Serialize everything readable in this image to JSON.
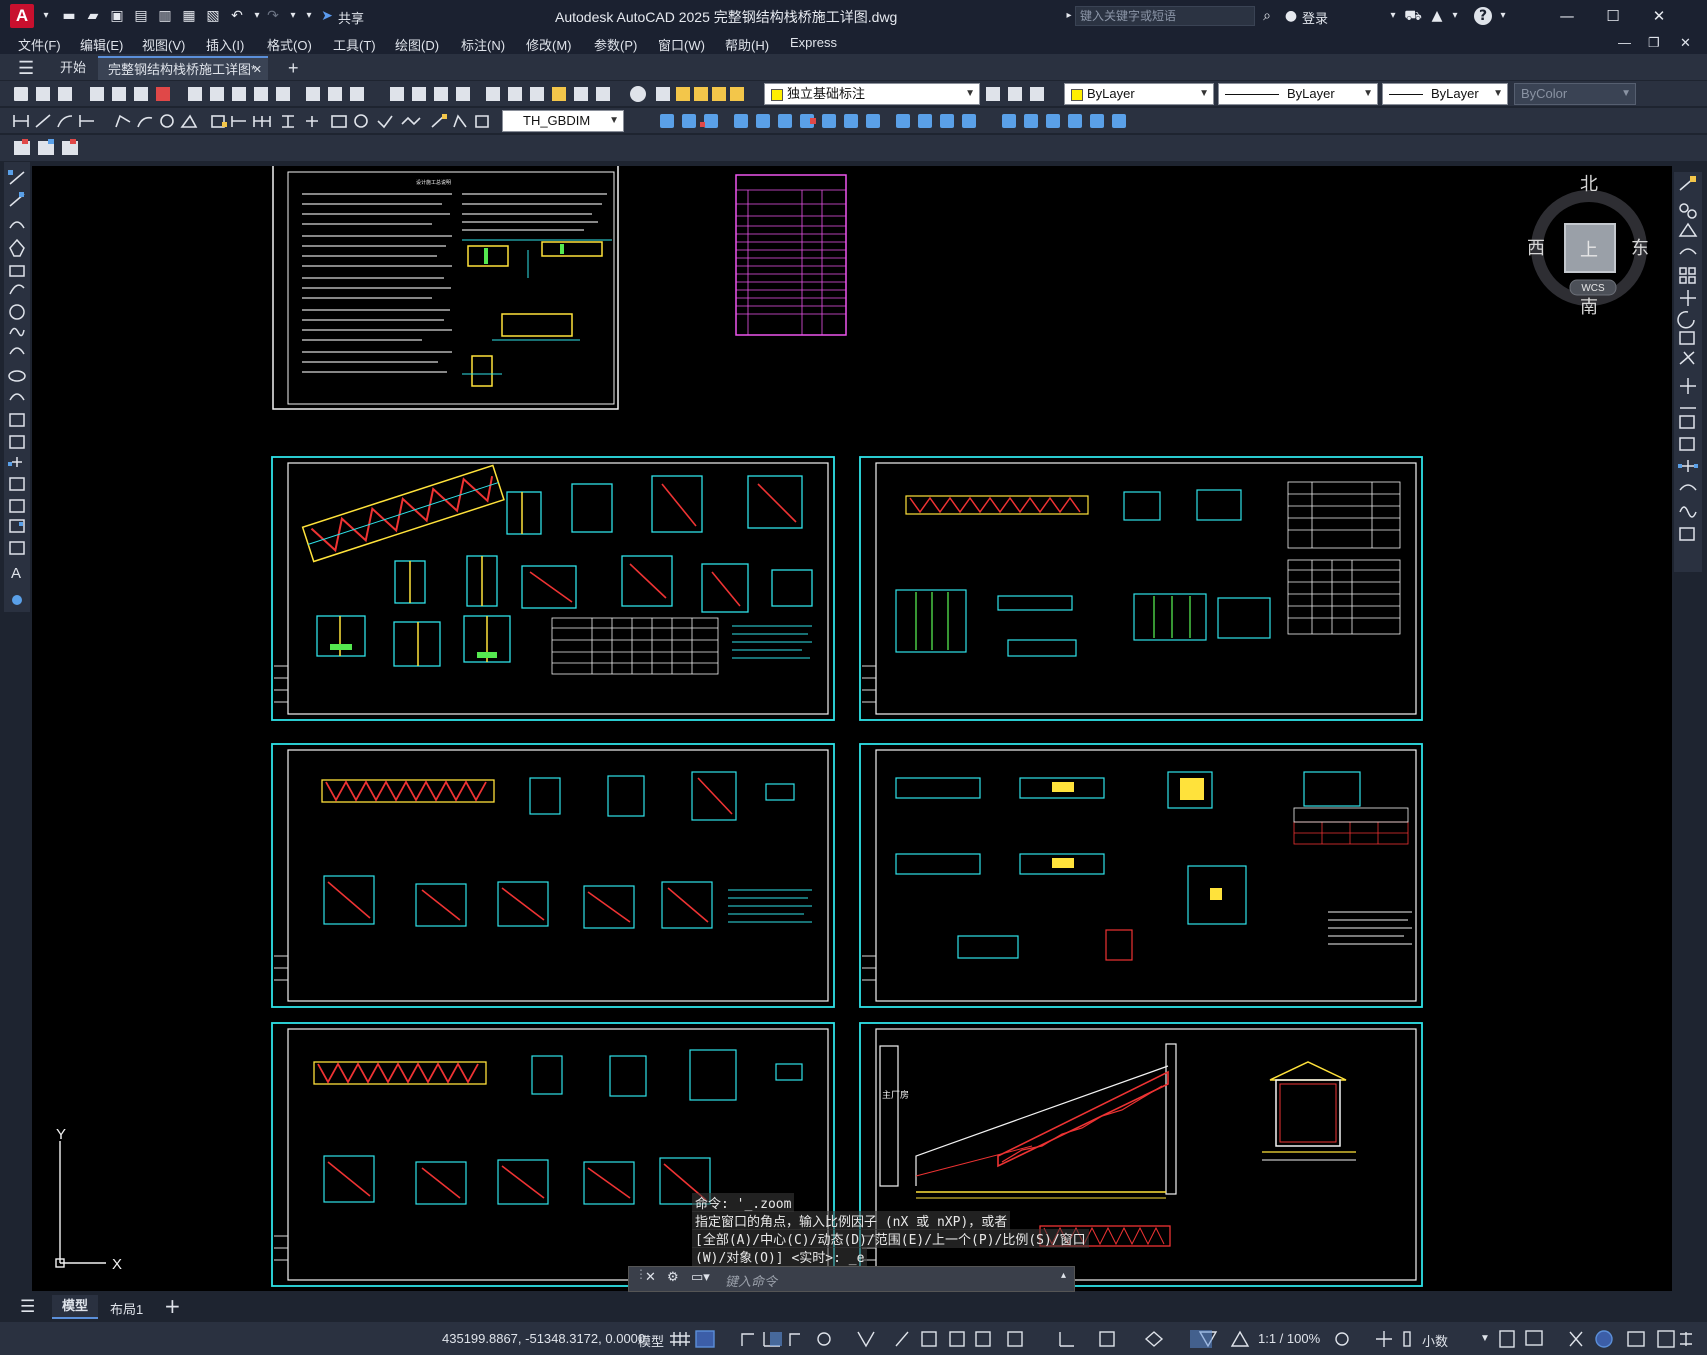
{
  "titlebar": {
    "app_letter": "A",
    "share_label": "共享",
    "title": "Autodesk AutoCAD 2025    完整钢结构栈桥施工详图.dwg",
    "search_placeholder": "键入关键字或短语",
    "login_label": "登录"
  },
  "menubar": {
    "items": [
      "文件(F)",
      "编辑(E)",
      "视图(V)",
      "插入(I)",
      "格式(O)",
      "工具(T)",
      "绘图(D)",
      "标注(N)",
      "修改(M)",
      "参数(P)",
      "窗口(W)",
      "帮助(H)",
      "Express"
    ]
  },
  "tabs": {
    "start": "开始",
    "document": "完整钢结构栈桥施工详图*",
    "close_glyph": "✕",
    "add_glyph": "+"
  },
  "toolbar": {
    "layer_value": "独立基础标注",
    "color_value": "ByLayer",
    "linetype_value": "ByLayer",
    "lineweight_value": "ByLayer",
    "plotstyle_value": "ByColor",
    "dimstyle_value": "TH_GBDIM"
  },
  "viewcube": {
    "north": "北",
    "south": "南",
    "east": "东",
    "west": "西",
    "face": "上",
    "wcs": "WCS"
  },
  "ucs": {
    "x_label": "X",
    "y_label": "Y"
  },
  "drawing_labels": {
    "main_factory": "主厂房",
    "sheet_note": "设计施工总说明"
  },
  "command": {
    "lines": [
      "命令: '_.zoom",
      "指定窗口的角点，输入比例因子 (nX 或 nXP)，或者",
      "[全部(A)/中心(C)/动态(D)/范围(E)/上一个(P)/比例(S)/窗口",
      "(W)/对象(O)] <实时>: _e"
    ],
    "input_placeholder": "键入命令"
  },
  "layout_tabs": {
    "model": "模型",
    "layout1": "布局1",
    "add_glyph": "+"
  },
  "statusbar": {
    "coordinates": "435199.8867, -51348.3172, 0.0000",
    "model_label": "模型",
    "scale": "1:1 / 100%",
    "units": "小数"
  }
}
